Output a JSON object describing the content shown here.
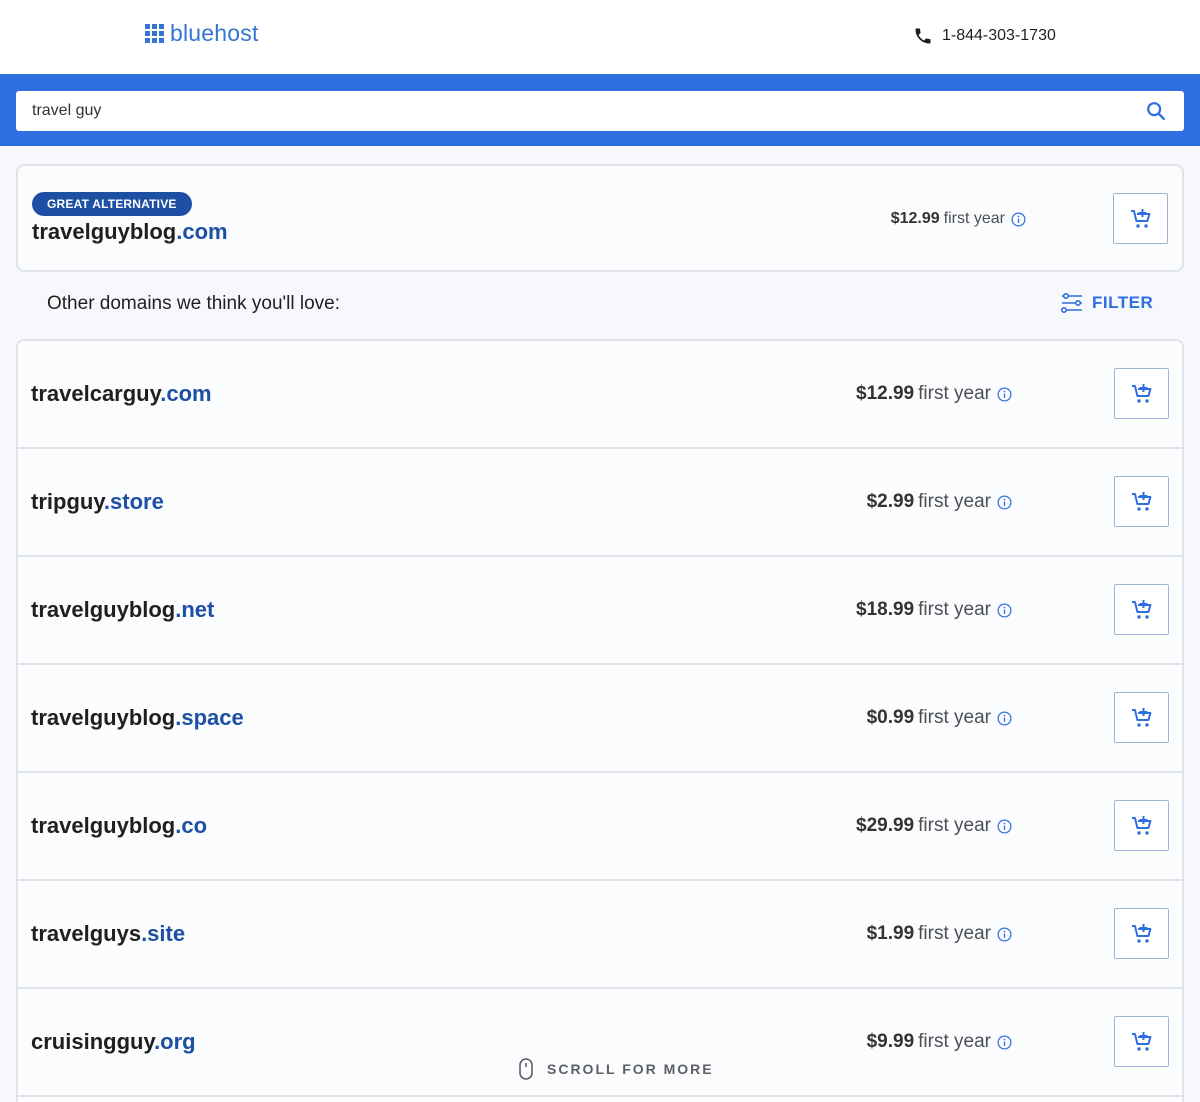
{
  "header": {
    "logo_text": "bluehost",
    "phone": "1-844-303-1730"
  },
  "search": {
    "value": "travel guy"
  },
  "featured": {
    "badge": "GREAT ALTERNATIVE",
    "name": "travelguyblog",
    "tld": ".com",
    "price": "$12.99",
    "price_suffix": "first year"
  },
  "subheading": "Other domains we think you'll love:",
  "filter_label": "FILTER",
  "results": [
    {
      "name": "travelcarguy",
      "tld": ".com",
      "price": "$12.99",
      "price_suffix": "first year"
    },
    {
      "name": "tripguy",
      "tld": ".store",
      "price": "$2.99",
      "price_suffix": "first year"
    },
    {
      "name": "travelguyblog",
      "tld": ".net",
      "price": "$18.99",
      "price_suffix": "first year"
    },
    {
      "name": "travelguyblog",
      "tld": ".space",
      "price": "$0.99",
      "price_suffix": "first year"
    },
    {
      "name": "travelguyblog",
      "tld": ".co",
      "price": "$29.99",
      "price_suffix": "first year"
    },
    {
      "name": "travelguys",
      "tld": ".site",
      "price": "$1.99",
      "price_suffix": "first year"
    },
    {
      "name": "cruisingguy",
      "tld": ".org",
      "price": "$9.99",
      "price_suffix": "first year"
    }
  ],
  "scroll_hint": "SCROLL FOR MORE",
  "colors": {
    "brand_blue": "#2f6ee0",
    "tld_blue": "#1d4fa3",
    "badge_bg": "#1d4fa3"
  },
  "icons": {
    "logo": "grid-icon",
    "phone": "phone-icon",
    "search": "search-icon",
    "info": "info-icon",
    "cart": "add-to-cart-icon",
    "filter": "filter-sliders-icon",
    "mouse": "mouse-icon"
  }
}
